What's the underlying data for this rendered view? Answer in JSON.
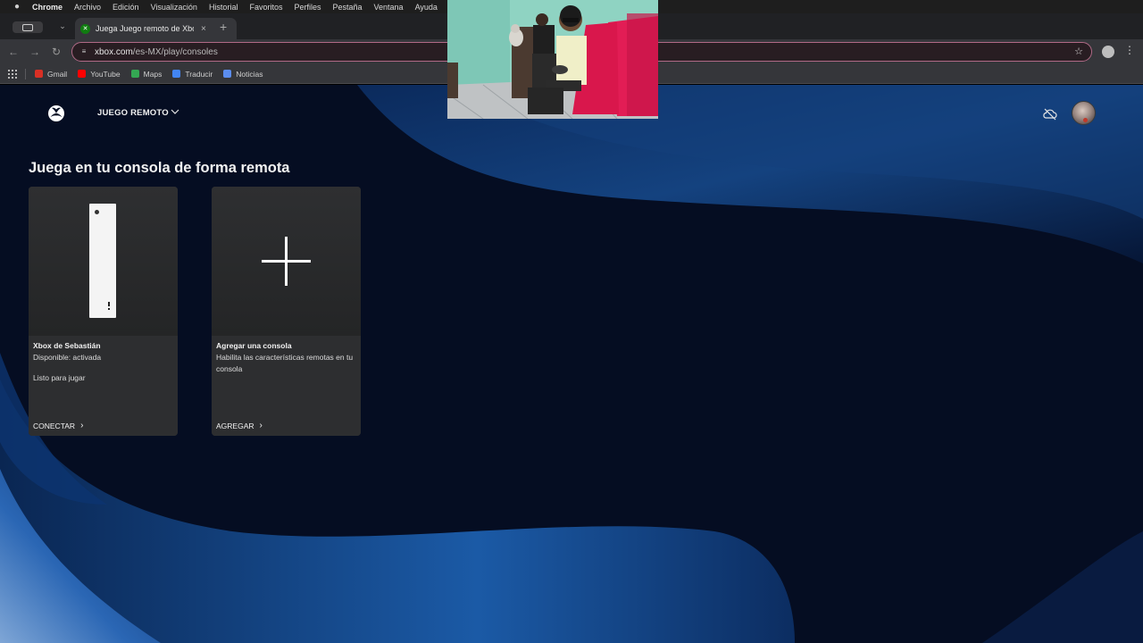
{
  "menubar": {
    "items": [
      "Chrome",
      "Archivo",
      "Edición",
      "Visualización",
      "Historial",
      "Favoritos",
      "Perfiles",
      "Pestaña",
      "Ventana",
      "Ayuda"
    ]
  },
  "tab": {
    "title": "Juega Juego remoto de Xbox",
    "close_glyph": "×"
  },
  "omnibox": {
    "url_domain": "xbox.com",
    "url_path": "/es-MX/play/consoles"
  },
  "bookmarks": [
    {
      "label": "Gmail",
      "color": "#d93025"
    },
    {
      "label": "YouTube",
      "color": "#ff0000"
    },
    {
      "label": "Maps",
      "color": "#34a853"
    },
    {
      "label": "Traducir",
      "color": "#4285f4"
    },
    {
      "label": "Noticias",
      "color": "#5b8def"
    }
  ],
  "xbox_nav": {
    "section_label": "JUEGO REMOTO"
  },
  "page": {
    "title": "Juega en tu consola de forma remota"
  },
  "cards": [
    {
      "name": "Xbox de Sebastián",
      "status": "Disponible: activada",
      "detail": "Listo para jugar",
      "action": "CONECTAR"
    },
    {
      "name": "Agregar una consola",
      "status": "Habilita las características remotas en tu consola",
      "detail": "",
      "action": "AGREGAR"
    }
  ],
  "colors": {
    "accent_green": "#107c10",
    "page_bg": "#050d22",
    "wave_blue": "#1a4f97",
    "omnibox_border": "#b06a86"
  },
  "icons": [
    "apple-icon",
    "sidebar-icon",
    "search-tabs-icon",
    "xbox-icon",
    "close-icon",
    "plus-icon",
    "back-icon",
    "forward-icon",
    "reload-icon",
    "site-info-icon",
    "star-icon",
    "menu-icon",
    "apps-icon",
    "chevron-down-icon",
    "cloud-icon",
    "chevron-right-icon"
  ]
}
